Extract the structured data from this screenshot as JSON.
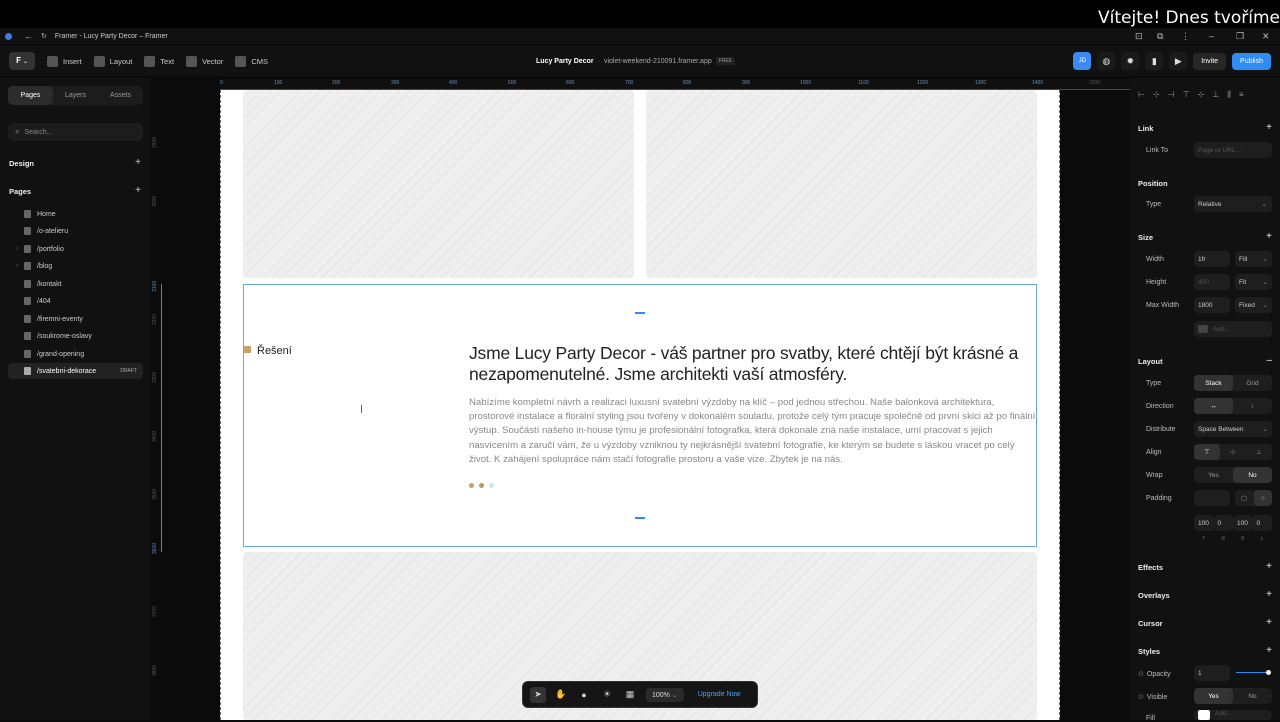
{
  "overlay": {
    "text": "Vítejte! Dnes tvoříme"
  },
  "browser": {
    "title": "Framer - Lucy Party Decor – Framer"
  },
  "toolbar": {
    "insert": "Insert",
    "layout": "Layout",
    "text": "Text",
    "vector": "Vector",
    "cms": "CMS",
    "project": "Lucy Party Decor",
    "separator": "·",
    "domain": "violet-weekend-210091.framer.app",
    "plan": "FREE",
    "avatar": "JD",
    "invite": "Invite",
    "publish": "Publish"
  },
  "leftpanel": {
    "tabs": [
      "Pages",
      "Layers",
      "Assets"
    ],
    "search_placeholder": "Search...",
    "design_label": "Design",
    "pages_label": "Pages",
    "pages": [
      {
        "name": "Home"
      },
      {
        "name": "/o-atelieru"
      },
      {
        "name": "/portfolio"
      },
      {
        "name": "/blog"
      },
      {
        "name": "/kontakt"
      },
      {
        "name": "/404"
      },
      {
        "name": "/firemni-eventy"
      },
      {
        "name": "/soukrome-oslavy"
      },
      {
        "name": "/grand-opening"
      },
      {
        "name": "/svatebni-dekorace",
        "badge": "DRAFT"
      }
    ]
  },
  "ruler_top": [
    "100",
    "200",
    "300",
    "400",
    "500",
    "600",
    "700",
    "800",
    "900",
    "1000",
    "1100",
    "1200",
    "1300",
    "1400",
    "1500"
  ],
  "ruler_left": [
    "2900",
    "3000",
    "3100",
    "3200",
    "3300",
    "3400",
    "3500",
    "3600",
    "3700",
    "3800"
  ],
  "canvas": {
    "tag": "Řešení",
    "headline": "Jsme Lucy Party Decor - váš partner pro svatby, které chtějí být krásné a nezapomenutelné. Jsme architekti vaší atmosféry.",
    "body": "Nabízíme kompletní návrh a realizaci luxusní svatební výzdoby na klíč – pod jednou střechou. Naše balonková architektura, prostorové instalace a florální styling jsou tvořeny v dokonalém souladu, protože celý tým pracuje společně od první skici až po finální výstup. Součástí našeho in-house týmu je profesionální fotografka, která dokonale zná naše instalace, umí pracovat s jejich nasvícením a zaručí vám, že u výzdoby vzniknou ty nejkrásnější svatební fotografie, ke kterým se budete s láskou vracet po celý život. K zahájení spolupráce nám stačí fotografie prostoru a vaše vize. Zbytek je na nás."
  },
  "rightpanel": {
    "link": {
      "title": "Link",
      "link_to": "Link To",
      "placeholder": "Page or URL..."
    },
    "position": {
      "title": "Position",
      "type_label": "Type",
      "type_value": "Relative"
    },
    "size": {
      "title": "Size",
      "width_label": "Width",
      "width_value": "1fr",
      "width_mode": "Fill",
      "height_label": "Height",
      "height_value": "450",
      "height_mode": "Fit",
      "maxw_label": "Max Width",
      "maxw_value": "1800",
      "maxw_mode": "Fixed",
      "add": "Add..."
    },
    "layout": {
      "title": "Layout",
      "type_label": "Type",
      "type_options": [
        "Stack",
        "Grid"
      ],
      "direction_label": "Direction",
      "distribute_label": "Distribute",
      "distribute_value": "Space Between",
      "align_label": "Align",
      "wrap_label": "Wrap",
      "wrap_options": [
        "Yes",
        "No"
      ],
      "padding_label": "Padding",
      "padding_values": [
        "100",
        "0",
        "100",
        "0"
      ],
      "padding_sides": [
        "T",
        "R",
        "B",
        "L"
      ]
    },
    "effects": "Effects",
    "overlays": "Overlays",
    "cursor": "Cursor",
    "styles": {
      "title": "Styles",
      "opacity_label": "Opacity",
      "opacity_value": "1",
      "visible_label": "Visible",
      "visible_options": [
        "Yes",
        "No"
      ],
      "fill_label": "Fill",
      "fill_value": "Add..."
    }
  },
  "bottombar": {
    "zoom": "100%",
    "upgrade": "Upgrade Now"
  },
  "colors": {
    "accent": "#2f8cf5",
    "tag": "#c8a066",
    "dot1": "#c8a066",
    "dot2": "#b89a5a",
    "dot3": "#d9e3ee"
  }
}
